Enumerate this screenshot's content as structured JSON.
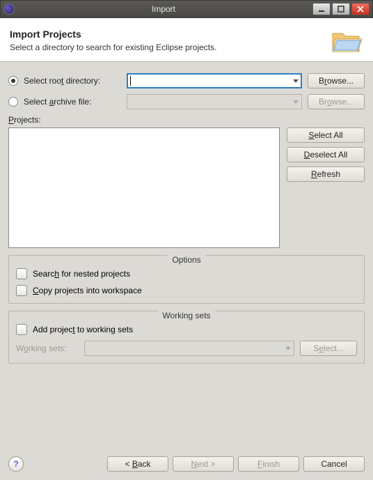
{
  "window": {
    "title": "Import"
  },
  "header": {
    "title": "Import Projects",
    "subtitle": "Select a directory to search for existing Eclipse projects."
  },
  "source": {
    "root_label_pre": "Select roo",
    "root_label_u": "t",
    "root_label_post": " directory:",
    "root_value": "",
    "archive_label_pre": "Select ",
    "archive_label_u": "a",
    "archive_label_post": "rchive file:",
    "archive_value": "",
    "browse_root": "Browse...",
    "browse_archive": "Browse..."
  },
  "projects": {
    "label_u": "P",
    "label_post": "rojects:",
    "select_all_u": "S",
    "select_all": "elect All",
    "deselect_all_u": "D",
    "deselect_all": "eselect All",
    "refresh_u": "R",
    "refresh": "efresh"
  },
  "options": {
    "legend": "Options",
    "nested_pre": "Searc",
    "nested_u": "h",
    "nested_post": " for nested projects",
    "copy_pre": "",
    "copy_u": "C",
    "copy_post": "opy projects into workspace"
  },
  "working_sets": {
    "legend": "Working sets",
    "add_pre": "Add projec",
    "add_u": "t",
    "add_post": " to working sets",
    "label_pre": "W",
    "label_u": "o",
    "label_post": "rking sets:",
    "select": "Select..."
  },
  "footer": {
    "help": "?",
    "back": "< Back",
    "next": "Next >",
    "finish": "Finish",
    "cancel": "Cancel"
  }
}
